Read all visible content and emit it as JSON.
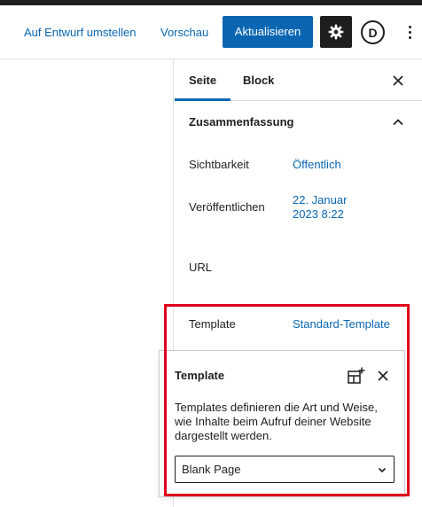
{
  "header": {
    "switch_to_draft": "Auf Entwurf umstellen",
    "preview": "Vorschau",
    "update": "Aktualisieren",
    "settings_icon": "gear-icon",
    "avatar_letter": "D",
    "more_icon": "more-vertical-icon"
  },
  "sidebar": {
    "tabs": [
      {
        "label": "Seite",
        "active": true
      },
      {
        "label": "Block",
        "active": false
      }
    ],
    "close_icon": "close-icon",
    "summary": {
      "title": "Zusammenfassung",
      "rows": [
        {
          "label": "Sichtbarkeit",
          "value": "Öffentlich"
        },
        {
          "label": "Veröffentlichen",
          "value_line1": "22. Januar",
          "value_line2": "2023 8:22"
        },
        {
          "label": "URL",
          "value": ""
        },
        {
          "label": "Template",
          "value": "Standard-Template"
        }
      ]
    }
  },
  "template_popover": {
    "title": "Template",
    "add_icon": "add-template-icon",
    "close_icon": "close-icon",
    "description": "Templates definieren die Art und Weise, wie Inhalte beim Aufruf deiner Website dargestellt werden.",
    "select_value": "Blank Page"
  },
  "colors": {
    "accent": "#0a66b2",
    "dark": "#1e1e1e",
    "highlight": "#e0001b"
  }
}
